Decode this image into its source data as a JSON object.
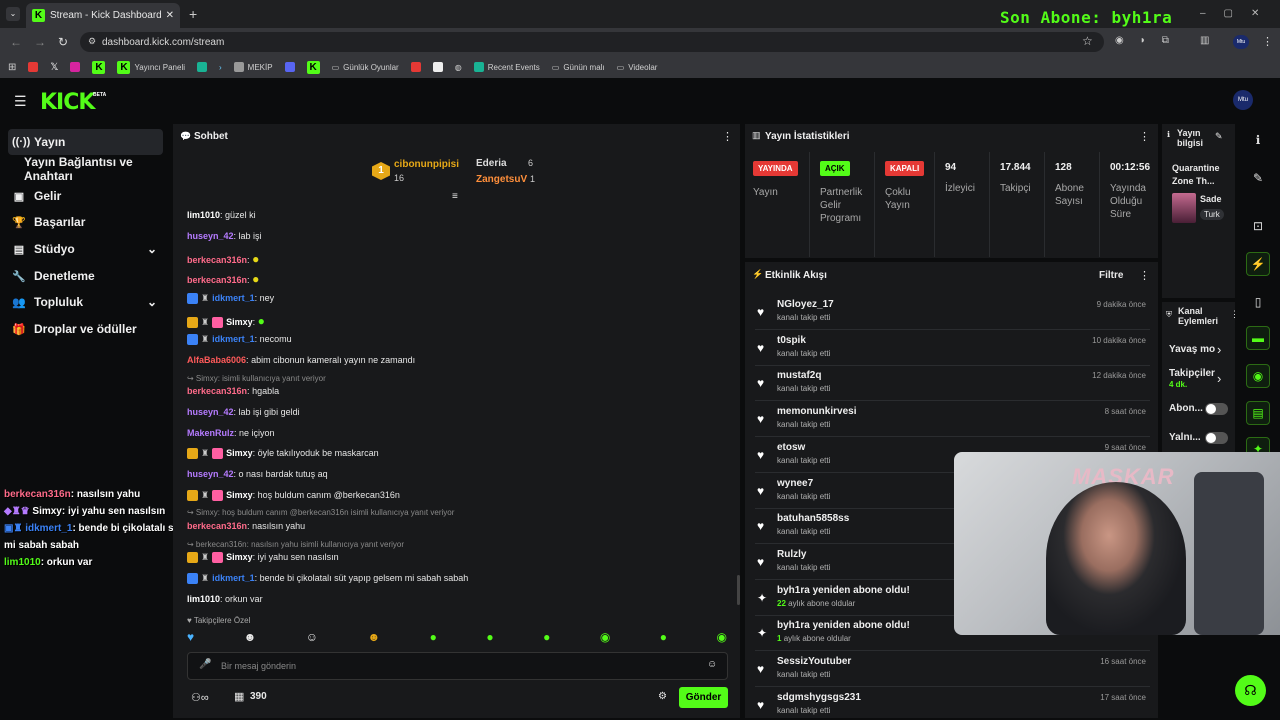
{
  "browser": {
    "tab_title": "Stream - Kick Dashboard",
    "url": "dashboard.kick.com/stream",
    "bookmarks": [
      "Yayıncı Paneli",
      "MEKİP",
      "Günlük Oyunlar",
      "Recent Events",
      "Günün malı",
      "Videolar"
    ]
  },
  "stream_overlay": {
    "last_sub": "Son Abone: byh1ra",
    "chat_lines": [
      {
        "user": "berkecan316n",
        "text": ": nasılsın yahu",
        "color": "#ff6b8a"
      },
      {
        "user": "Simxy",
        "text": ": iyi yahu sen nasılsın",
        "color": "#ffffff"
      },
      {
        "user": "idkmert_1",
        "text": ": bende bi çikolatalı süt yapıp gelsem",
        "color": "#3b82f6"
      },
      {
        "user": "",
        "text": "mi sabah sabah",
        "color": "#ffffff"
      },
      {
        "user": "lim1010",
        "text": ": orkun var",
        "color": "#53fc18"
      }
    ],
    "webcam_text": "MASKAR"
  },
  "kick": {
    "logo": "KICK",
    "beta": "BETA"
  },
  "sidebar": {
    "items": [
      {
        "label": "Yayın",
        "icon": "broadcast-icon"
      },
      {
        "label": "Yayın Bağlantısı ve Anahtarı",
        "icon": ""
      },
      {
        "label": "Gelir",
        "icon": "money-icon"
      },
      {
        "label": "Başarılar",
        "icon": "trophy-icon"
      },
      {
        "label": "Stüdyo",
        "icon": "studio-icon"
      },
      {
        "label": "Denetleme",
        "icon": "wrench-icon"
      },
      {
        "label": "Topluluk",
        "icon": "people-icon"
      },
      {
        "label": "Droplar ve ödüller",
        "icon": "gift-icon"
      }
    ]
  },
  "chat": {
    "title": "Sohbet",
    "leaders": [
      {
        "name": "cibonunpipisi",
        "value": "16"
      },
      {
        "name": "Ederia",
        "value": "6"
      },
      {
        "name": "ZangetsuV",
        "value": "1"
      }
    ],
    "messages": [
      {
        "user": "lim1010",
        "sep": ": ",
        "text": "güzel ki",
        "color": "u-white"
      },
      {
        "user": "huseyn_42",
        "sep": ": ",
        "text": "lab işi",
        "color": "u-purple"
      },
      {
        "user": "berkecan316n",
        "sep": ":",
        "text": "",
        "color": "u-pink"
      },
      {
        "user": "berkecan316n",
        "sep": ":",
        "text": "",
        "color": "u-pink"
      },
      {
        "user": "idkmert_1",
        "sep": ": ",
        "text": "ney",
        "color": "u-blue"
      },
      {
        "user": "Simxy",
        "sep": ":",
        "text": "",
        "color": "u-white"
      },
      {
        "user": "idkmert_1",
        "sep": ": ",
        "text": "necomu",
        "color": "u-blue"
      },
      {
        "user": "AlfaBaba6006",
        "sep": ": ",
        "text": "abim cibonun kameralı yayın ne zamandı",
        "color": "u-red"
      },
      {
        "user": "berkecan316n",
        "sep": ": ",
        "text": "hgabla",
        "color": "u-pink"
      },
      {
        "user": "huseyn_42",
        "sep": ": ",
        "text": "lab işi gibi geldi",
        "color": "u-purple"
      },
      {
        "user": "MakenRulz",
        "sep": ": ",
        "text": "ne içiyon",
        "color": "u-purple"
      },
      {
        "user": "Simxy",
        "sep": ": ",
        "text": "öyle takılıyoduk be maskarcan",
        "color": "u-white"
      },
      {
        "user": "huseyn_42",
        "sep": ": ",
        "text": "o nası bardak tutuş aq",
        "color": "u-purple"
      },
      {
        "user": "Simxy",
        "sep": ": ",
        "text": "hoş buldum canım @berkecan316n",
        "color": "u-white"
      },
      {
        "user": "berkecan316n",
        "sep": ": ",
        "text": "nasılsın yahu",
        "color": "u-pink"
      },
      {
        "user": "Simxy",
        "sep": ": ",
        "text": "iyi yahu sen nasılsın",
        "color": "u-white"
      },
      {
        "user": "idkmert_1",
        "sep": ": ",
        "text": "bende bi çikolatalı süt yapıp gelsem mi sabah sabah",
        "color": "u-blue"
      },
      {
        "user": "lim1010",
        "sep": ": ",
        "text": "orkun var",
        "color": "u-white"
      }
    ],
    "replies": [
      "↪ Simxy:       isimli kullanıcıya yanıt veriyor",
      "↪ Simxy: hoş buldum canım @berkecan316n isimli kullanıcıya yanıt veriyor",
      "↪ berkecan316n: nasılsın yahu isimli kullanıcıya yanıt veriyor"
    ],
    "followers_only": "Takipçilere Özel",
    "input_placeholder": "Bir mesaj gönderin",
    "points": "390",
    "send": "Gönder"
  },
  "stats": {
    "title": "Yayın İstatistikleri",
    "items": [
      {
        "pill": "YAYINDA",
        "label": "Yayın",
        "color": "#e53935"
      },
      {
        "pill": "AÇIK",
        "label": "Partnerlik Gelir Programı",
        "color": "#53fc18"
      },
      {
        "pill": "KAPALI",
        "label": "Çoklu Yayın",
        "color": "#e53935"
      },
      {
        "value": "94",
        "label": "İzleyici"
      },
      {
        "value": "17.844",
        "label": "Takipçi"
      },
      {
        "value": "128",
        "label": "Abone Sayısı"
      },
      {
        "value": "00:12:56",
        "label": "Yayında Olduğu Süre"
      }
    ]
  },
  "activity": {
    "title": "Etkinlik Akışı",
    "filter": "Filtre",
    "items": [
      {
        "name": "NGloyez_17",
        "sub": "kanalı takip etti",
        "time": "9 dakika önce",
        "icon": "heart"
      },
      {
        "name": "t0spik",
        "sub": "kanalı takip etti",
        "time": "10 dakika önce",
        "icon": "heart"
      },
      {
        "name": "mustaf2q",
        "sub": "kanalı takip etti",
        "time": "12 dakika önce",
        "icon": "heart"
      },
      {
        "name": "memonunkirvesi",
        "sub": "kanalı takip etti",
        "time": "8 saat önce",
        "icon": "heart"
      },
      {
        "name": "etosw",
        "sub": "kanalı takip etti",
        "time": "9 saat önce",
        "icon": "heart"
      },
      {
        "name": "wynee7",
        "sub": "kanalı takip etti",
        "time": "",
        "icon": "heart"
      },
      {
        "name": "batuhan5858ss",
        "sub": "kanalı takip etti",
        "time": "",
        "icon": "heart"
      },
      {
        "name": "Rulzly",
        "sub": "kanalı takip etti",
        "time": "",
        "icon": "heart"
      },
      {
        "name": "byh1ra yeniden abone oldu!",
        "sub": "aylık abone oldular",
        "num": "22",
        "time": "",
        "icon": "spark"
      },
      {
        "name": "byh1ra yeniden abone oldu!",
        "sub": "aylık abone oldular",
        "num": "1",
        "time": "",
        "icon": "spark"
      },
      {
        "name": "SessizYoutuber",
        "sub": "kanalı takip etti",
        "time": "16 saat önce",
        "icon": "heart"
      },
      {
        "name": "sdgmshygsgs231",
        "sub": "kanalı takip etti",
        "time": "17 saat önce",
        "icon": "heart"
      }
    ]
  },
  "stream_info": {
    "title": "Yayın bilgisi",
    "stream_title": "Quarantine Zone Th...",
    "category": "Sade",
    "tag": "Turk"
  },
  "channel_actions": {
    "title": "Kanal Eylemleri",
    "items": [
      {
        "label": "Yavaş mo",
        "extra": ""
      },
      {
        "label": "Takipçiler",
        "extra": "4 dk."
      },
      {
        "label": "Abon...",
        "extra": ""
      },
      {
        "label": "Yalnı...",
        "extra": ""
      }
    ]
  }
}
